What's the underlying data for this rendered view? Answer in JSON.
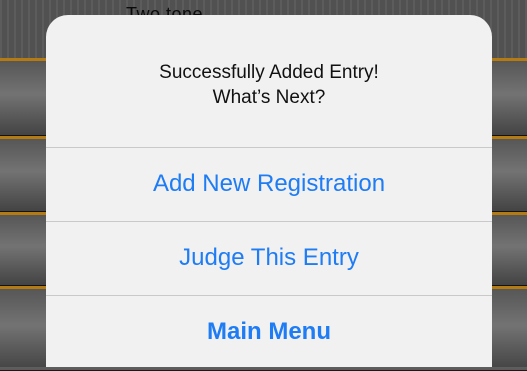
{
  "background": {
    "header_title": "Two tone"
  },
  "alert": {
    "title_line1": "Successfully Added Entry!",
    "title_line2": "What’s Next?",
    "buttons": [
      {
        "label": "Add New Registration"
      },
      {
        "label": "Judge This Entry"
      },
      {
        "label": "Main Menu"
      }
    ]
  },
  "colors": {
    "accent_blue": "#1e7cf4",
    "row_divider_orange": "#f0a418",
    "alert_background": "#f1f1f1"
  }
}
